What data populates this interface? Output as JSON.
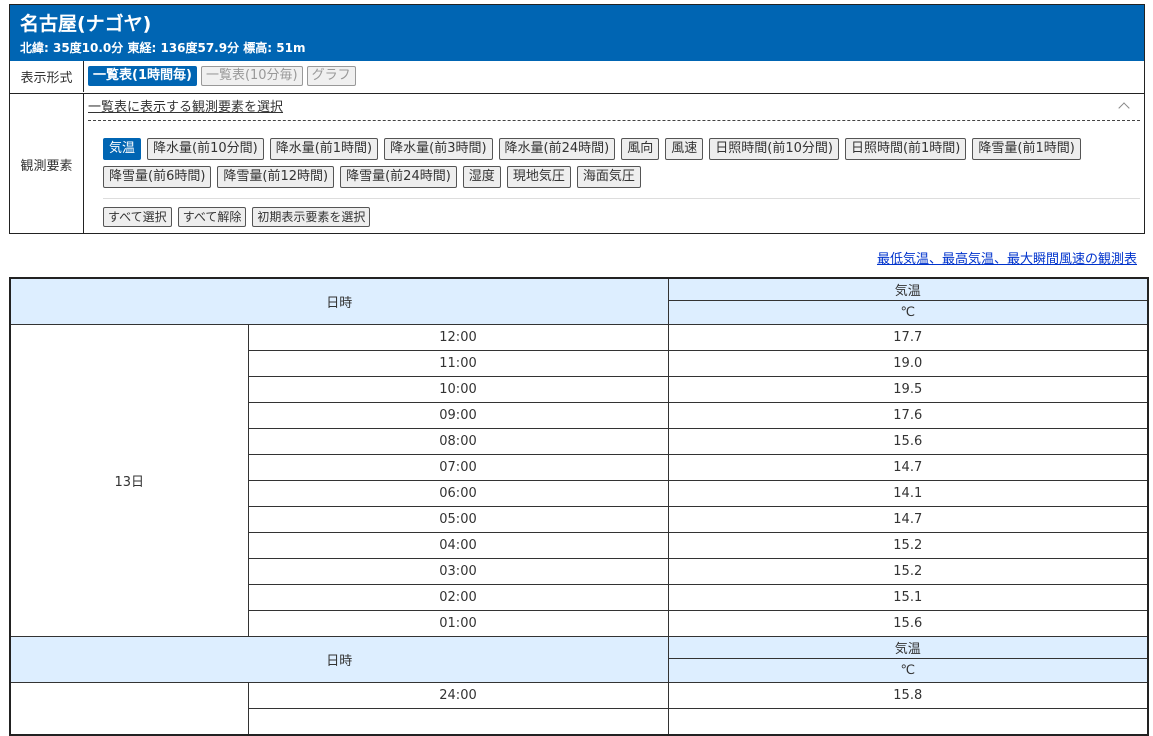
{
  "station": {
    "name": "名古屋(ナゴヤ)",
    "coords": "北緯: 35度10.0分 東経: 136度57.9分 標高: 51m"
  },
  "format": {
    "label": "表示形式",
    "buttons": [
      {
        "label": "一覧表(1時間毎)",
        "active": true
      },
      {
        "label": "一覧表(10分毎)",
        "active": false
      },
      {
        "label": "グラフ",
        "active": false
      }
    ]
  },
  "elements": {
    "label": "観測要素",
    "toggle_text": "一覧表に表示する観測要素を選択",
    "buttons": [
      {
        "label": "気温",
        "active": true
      },
      {
        "label": "降水量(前10分間)",
        "active": false
      },
      {
        "label": "降水量(前1時間)",
        "active": false
      },
      {
        "label": "降水量(前3時間)",
        "active": false
      },
      {
        "label": "降水量(前24時間)",
        "active": false
      },
      {
        "label": "風向",
        "active": false
      },
      {
        "label": "風速",
        "active": false
      },
      {
        "label": "日照時間(前10分間)",
        "active": false
      },
      {
        "label": "日照時間(前1時間)",
        "active": false
      },
      {
        "label": "降雪量(前1時間)",
        "active": false
      },
      {
        "label": "降雪量(前6時間)",
        "active": false
      },
      {
        "label": "降雪量(前12時間)",
        "active": false
      },
      {
        "label": "降雪量(前24時間)",
        "active": false
      },
      {
        "label": "湿度",
        "active": false
      },
      {
        "label": "現地気圧",
        "active": false
      },
      {
        "label": "海面気圧",
        "active": false
      }
    ],
    "actions": [
      "すべて選択",
      "すべて解除",
      "初期表示要素を選択"
    ]
  },
  "extremes_link": "最低気温、最高気温、最大瞬間風速の観測表",
  "table": {
    "header": {
      "datetime": "日時",
      "element": "気温",
      "unit": "℃"
    },
    "blocks": [
      {
        "day": "13日",
        "rows": [
          {
            "time": "12:00",
            "temp": "17.7"
          },
          {
            "time": "11:00",
            "temp": "19.0"
          },
          {
            "time": "10:00",
            "temp": "19.5"
          },
          {
            "time": "09:00",
            "temp": "17.6"
          },
          {
            "time": "08:00",
            "temp": "15.6"
          },
          {
            "time": "07:00",
            "temp": "14.7"
          },
          {
            "time": "06:00",
            "temp": "14.1"
          },
          {
            "time": "05:00",
            "temp": "14.7"
          },
          {
            "time": "04:00",
            "temp": "15.2"
          },
          {
            "time": "03:00",
            "temp": "15.2"
          },
          {
            "time": "02:00",
            "temp": "15.1"
          },
          {
            "time": "01:00",
            "temp": "15.6"
          }
        ]
      },
      {
        "day": "",
        "rows": [
          {
            "time": "24:00",
            "temp": "15.8"
          },
          {
            "time": "",
            "temp": ""
          }
        ]
      }
    ]
  },
  "colors": {
    "header_blue": "#0065b3",
    "table_header": "#ddeeff",
    "link": "#0033cc"
  }
}
